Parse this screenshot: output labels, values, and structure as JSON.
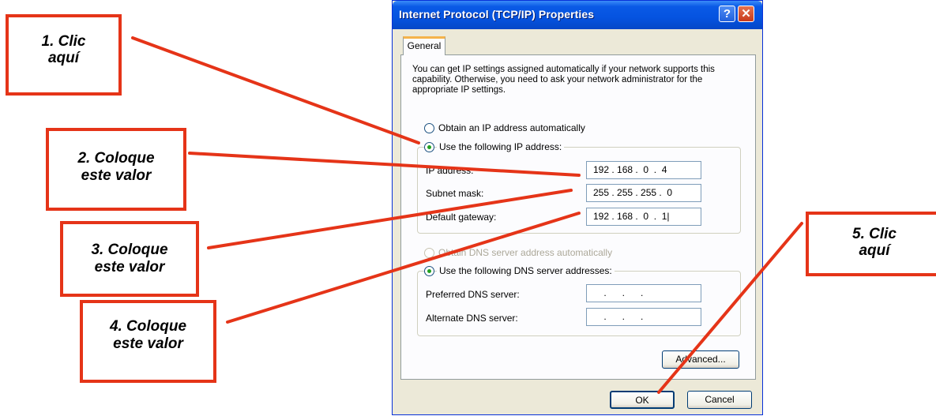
{
  "dialog": {
    "title": "Internet Protocol (TCP/IP) Properties",
    "help_glyph": "?",
    "close_glyph": "✕",
    "tab_general": "General",
    "description": "You can get IP settings assigned automatically if your network supports this capability. Otherwise, you need to ask your network administrator for the appropriate IP settings.",
    "obtain_ip_label": "Obtain an IP address automatically",
    "use_ip_label": "Use the following IP address:",
    "ip_address_label": "IP address:",
    "ip_address_value": "192 . 168 .  0  .  4",
    "subnet_label": "Subnet mask:",
    "subnet_value": "255 . 255 . 255 .  0",
    "gateway_label": "Default gateway:",
    "gateway_value": "192 . 168 .  0  .  1|",
    "obtain_dns_label": "Obtain DNS server address automatically",
    "use_dns_label": "Use the following DNS server addresses:",
    "preferred_dns_label": "Preferred DNS server:",
    "preferred_dns_value": "    .      .      .",
    "alternate_dns_label": "Alternate DNS server:",
    "alternate_dns_value": "    .      .      .",
    "advanced_label": "Advanced...",
    "ok_label": "OK",
    "cancel_label": "Cancel"
  },
  "annotations": {
    "step1": [
      "1. Clic",
      "aquí"
    ],
    "step2": [
      "2. Coloque",
      "este valor"
    ],
    "step3": [
      "3. Coloque",
      "este valor"
    ],
    "step4": [
      "4. Coloque",
      "este valor"
    ],
    "step5": [
      "5. Clic",
      "aquí"
    ]
  },
  "colors": {
    "annotation_red": "#e53418",
    "titlebar_blue": "#0553e0",
    "dialog_face": "#ece9d8"
  }
}
